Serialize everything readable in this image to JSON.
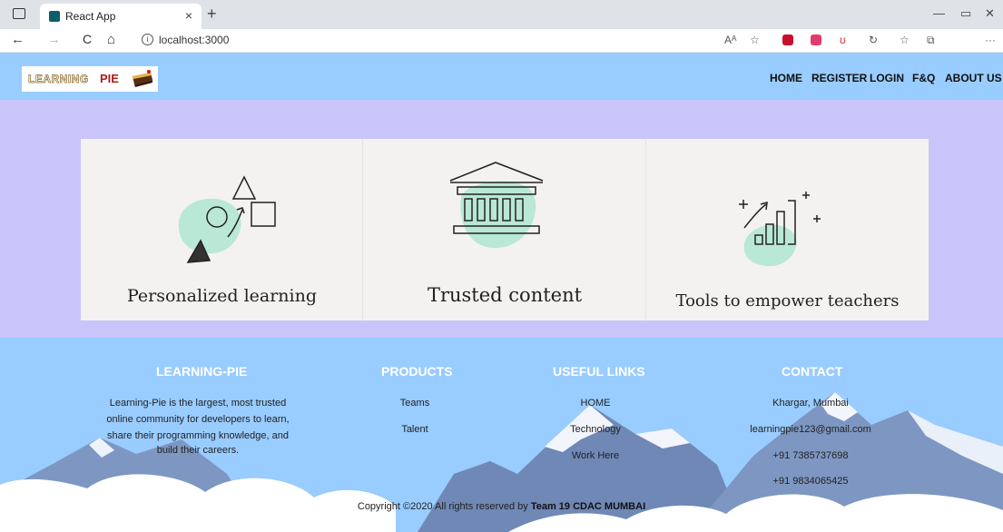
{
  "browser": {
    "tab_title": "React App",
    "tab_close": "×",
    "new_tab": "+",
    "url": "localhost:3000",
    "back": "←",
    "forward": "→",
    "reload": "C",
    "home": "⌂",
    "info": "i",
    "read_aloud": "Aᴬ",
    "minimize": "—",
    "restore": "▭",
    "close": "✕",
    "more": "···"
  },
  "navbar": {
    "logo_text1": "LEARNING",
    "logo_text2": "PIE",
    "links": [
      "HOME",
      "REGISTER",
      "LOGIN",
      "F&Q",
      "ABOUT US"
    ]
  },
  "cards": [
    {
      "label": "Personalized learning"
    },
    {
      "label": "Trusted content"
    },
    {
      "label": "Tools to empower teachers"
    }
  ],
  "footer": {
    "about": {
      "heading": "LEARNING-PIE",
      "lines": [
        "Learning-Pie is the largest, most trusted",
        "online community for developers to learn,",
        "share their programming knowledge, and",
        "build their careers."
      ]
    },
    "products": {
      "heading": "PRODUCTS",
      "items": [
        "Teams",
        "Talent"
      ]
    },
    "useful_links": {
      "heading": "USEFUL LINKS",
      "items": [
        "HOME",
        "Technology",
        "Work Here"
      ]
    },
    "contact": {
      "heading": "CONTACT",
      "items": [
        "Khargar, Mumbai",
        "learningpie123@gmail.com",
        "+91 7385737698",
        "+91 9834065425"
      ]
    },
    "copyright_prefix": "Copyright ©2020 All rights reserved by",
    "copyright_team": "Team 19 CDAC MUMBAI"
  },
  "colors": {
    "navbar_bg": "#99ccff",
    "hero_bg": "#c9c5fb",
    "card_bg": "#f4f2f1",
    "blob": "#b9e8d6",
    "footer_bg": "#99ccff"
  }
}
